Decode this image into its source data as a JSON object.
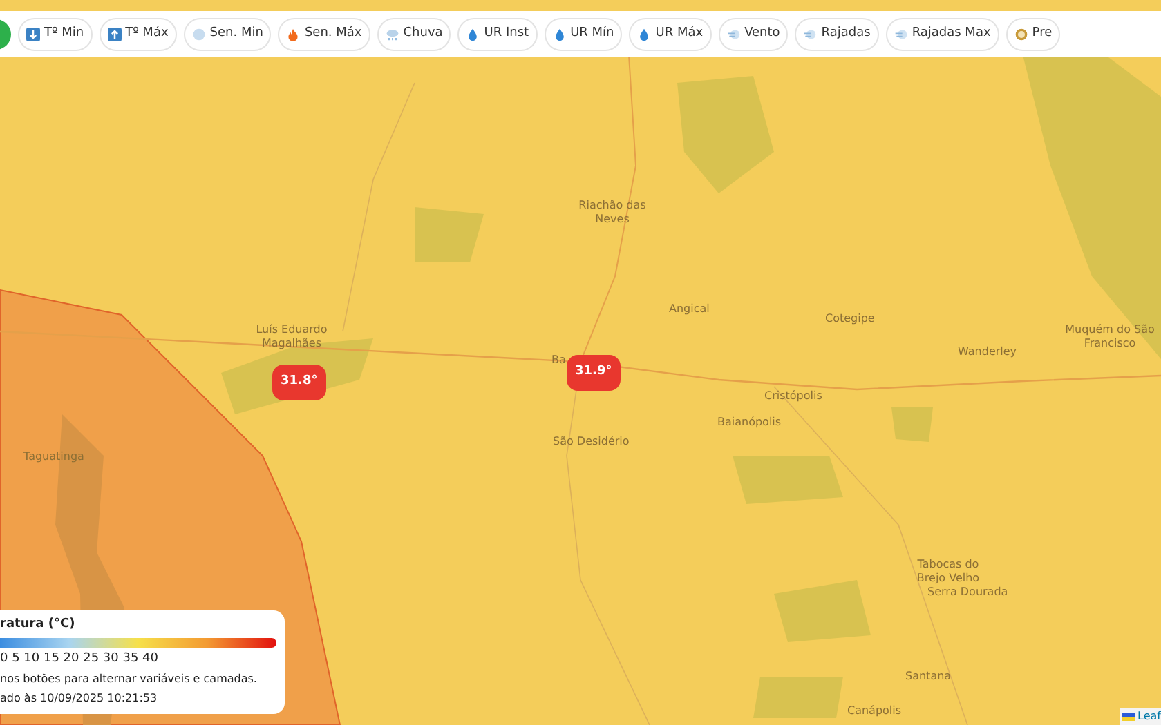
{
  "toolbar": {
    "buttons": [
      {
        "kind": "temp_min",
        "label": "Tº Min"
      },
      {
        "kind": "temp_max",
        "label": "Tº Máx"
      },
      {
        "kind": "feels_min",
        "label": "Sen. Min"
      },
      {
        "kind": "feels_max",
        "label": "Sen. Máx"
      },
      {
        "kind": "rain",
        "label": "Chuva"
      },
      {
        "kind": "humidity",
        "label": "UR Inst"
      },
      {
        "kind": "humidity",
        "label": "UR Mín"
      },
      {
        "kind": "humidity",
        "label": "UR Máx"
      },
      {
        "kind": "wind",
        "label": "Vento"
      },
      {
        "kind": "wind",
        "label": "Rajadas"
      },
      {
        "kind": "wind",
        "label": "Rajadas Max"
      },
      {
        "kind": "pressure",
        "label": "Pre"
      }
    ]
  },
  "map": {
    "places": [
      "Riachão das Neves",
      "Luís Eduardo Magalhães",
      "Angical",
      "Cotegipe",
      "Wanderley",
      "Muquém do São Francisco",
      "Ba",
      "Cristópolis",
      "Baianópolis",
      "São Desidério",
      "Taguatinga",
      "Tabocas do Brejo Velho",
      "Serra Dourada",
      "Santana",
      "Canápolis"
    ],
    "markers": [
      "31.8°",
      "31.9°"
    ],
    "attribution": "Leaf"
  },
  "legend": {
    "title": "ratura (°C)",
    "scale": "0 5 10 15 20 25 30 35 40",
    "hint": "nos botões para alternar variáveis e camadas.",
    "updated": "ado às 10/09/2025 10:21:53"
  }
}
